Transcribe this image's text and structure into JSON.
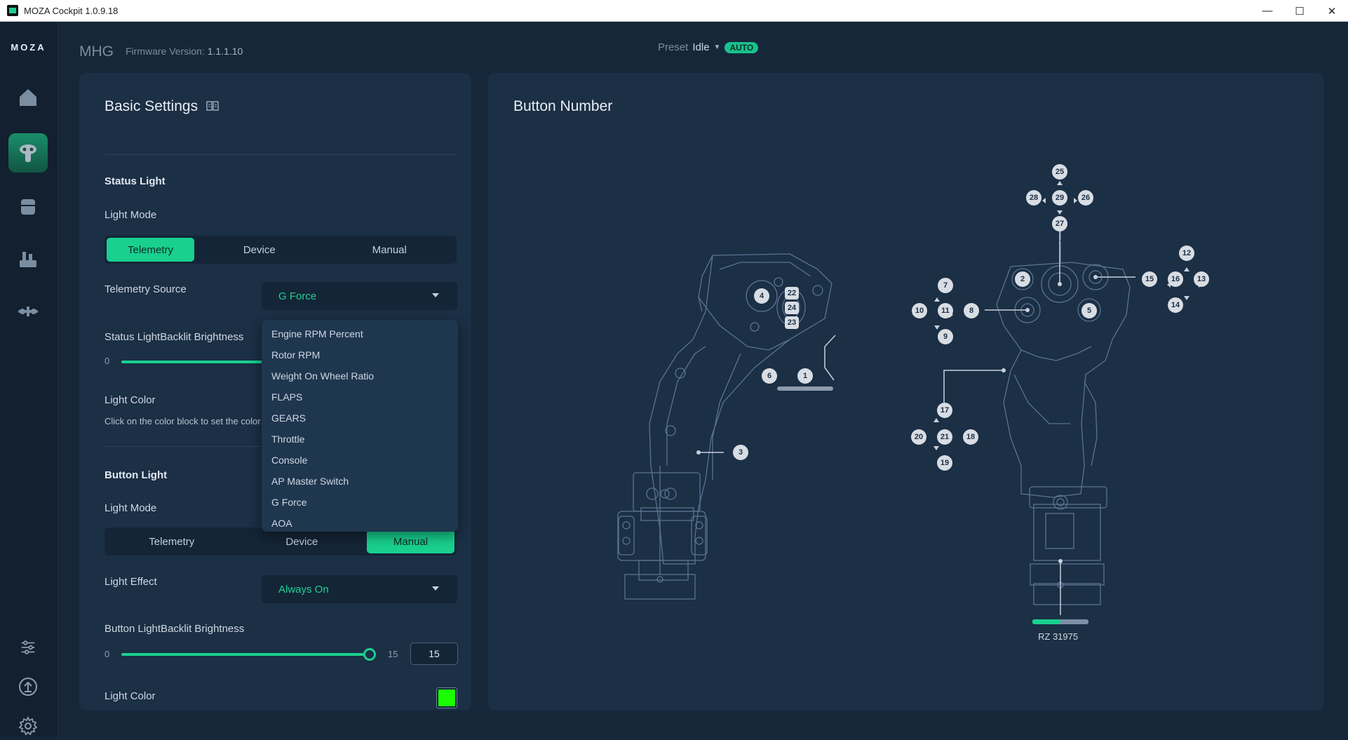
{
  "window": {
    "title": "MOZA Cockpit 1.0.9.18",
    "minimize_glyph": "—",
    "maximize_glyph": "☐",
    "close_glyph": "✕"
  },
  "sidebar": {
    "logo": "MOZA",
    "items": [
      {
        "name": "home",
        "icon": "home-icon"
      },
      {
        "name": "joystick",
        "icon": "joystick-icon",
        "active": true
      },
      {
        "name": "base",
        "icon": "base-icon"
      },
      {
        "name": "throttle",
        "icon": "throttle-icon"
      },
      {
        "name": "pedals",
        "icon": "pedals-icon"
      }
    ],
    "bottom": [
      {
        "name": "sliders",
        "icon": "sliders-icon"
      },
      {
        "name": "upgrade",
        "icon": "upload-icon"
      },
      {
        "name": "settings",
        "icon": "gear-icon"
      }
    ]
  },
  "header": {
    "device": "MHG",
    "firmware_label": "Firmware Version:",
    "firmware_value": "1.1.1.10",
    "preset_label": "Preset",
    "preset_value": "Idle",
    "auto_badge": "AUTO"
  },
  "basic_settings": {
    "title": "Basic Settings",
    "status_light": {
      "section": "Status Light",
      "light_mode_label": "Light Mode",
      "modes": [
        "Telemetry",
        "Device",
        "Manual"
      ],
      "active_mode": "Telemetry",
      "telemetry_source_label": "Telemetry Source",
      "telemetry_source_value": "G Force",
      "brightness_label": "Status LightBacklit Brightness",
      "brightness_min": "0",
      "light_color_label": "Light Color",
      "light_color_hint": "Click on the color block to set the color"
    },
    "button_light": {
      "section": "Button Light",
      "light_mode_label": "Light Mode",
      "modes": [
        "Telemetry",
        "Device",
        "Manual"
      ],
      "active_mode": "Manual",
      "light_effect_label": "Light Effect",
      "light_effect_value": "Always On",
      "brightness_label": "Button LightBacklit Brightness",
      "brightness_min": "0",
      "brightness_max": "15",
      "brightness_value": "15",
      "brightness_fraction": 1.0,
      "light_color_label": "Light Color",
      "light_color": "#1aff00"
    },
    "telemetry_dropdown": [
      "Engine RPM Percent",
      "Rotor RPM",
      "Weight On Wheel Ratio",
      "FLAPS",
      "GEARS",
      "Throttle",
      "Console",
      "AP Master Switch",
      "G Force",
      "AOA"
    ]
  },
  "button_number": {
    "title": "Button Number",
    "side_view_buttons": [
      "4",
      "22",
      "24",
      "23",
      "6",
      "1",
      "3"
    ],
    "front_view_buttons": [
      "25",
      "28",
      "29",
      "26",
      "27",
      "2",
      "12",
      "15",
      "16",
      "13",
      "14",
      "7",
      "10",
      "11",
      "8",
      "9",
      "5",
      "17",
      "20",
      "21",
      "18",
      "19"
    ],
    "rz_label": "RZ 31975",
    "rz_fraction": 0.5
  },
  "colors": {
    "accent": "#19d08f",
    "panel": "#1b2f45",
    "background": "#16273a"
  }
}
